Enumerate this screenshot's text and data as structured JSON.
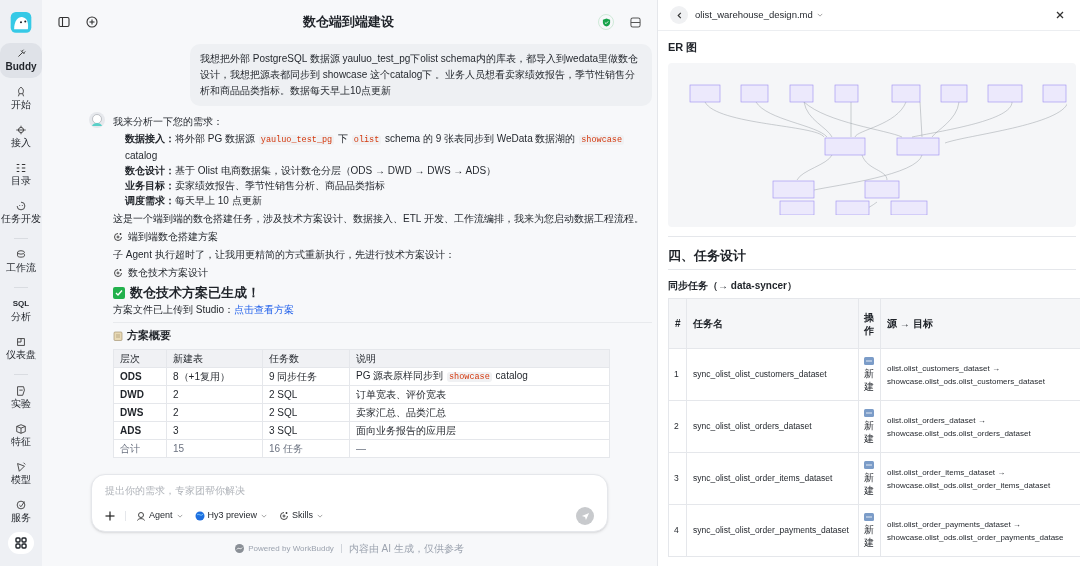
{
  "sidebar": {
    "groups": [
      [
        {
          "label": "Buddy",
          "selected": true
        },
        {
          "label": "开始",
          "selected": false
        },
        {
          "label": "接入",
          "selected": false
        },
        {
          "label": "目录",
          "selected": false
        },
        {
          "label": "任务开发",
          "selected": false
        }
      ],
      [
        {
          "label": "工作流",
          "selected": false
        }
      ],
      [
        {
          "label": "分析",
          "icon_text": "SQL",
          "selected": false
        },
        {
          "label": "仪表盘",
          "selected": false
        }
      ],
      [
        {
          "label": "实验",
          "selected": false
        },
        {
          "label": "特征",
          "selected": false
        },
        {
          "label": "模型",
          "selected": false
        },
        {
          "label": "服务",
          "selected": false
        }
      ]
    ]
  },
  "chat": {
    "title": "数仓端到端建设",
    "user_message": "我想把外部 PostgreSQL 数据源 yauluo_test_pg下olist schema内的库表，都导入到wedata里做数仓设计，我想把源表都同步到 showcase 这个catalog下 。业务人员想看卖家绩效报告，季节性销售分析和商品品类指标。数据每天早上10点更新",
    "reply": {
      "intro": "我来分析一下您的需求：",
      "requirements": [
        {
          "label": "数据接入：",
          "segments": [
            {
              "kind": "text",
              "text": "将外部 PG 数据源 "
            },
            {
              "kind": "code",
              "text": "yauluo_test_pg"
            },
            {
              "kind": "text",
              "text": " 下 "
            },
            {
              "kind": "code",
              "text": "olist"
            },
            {
              "kind": "text",
              "text": " schema 的 9 张表同步到 WeData 数据湖的 "
            },
            {
              "kind": "code",
              "text": "showcase"
            },
            {
              "kind": "text",
              "text": " catalog"
            }
          ]
        },
        {
          "label": "数仓设计：",
          "segments": [
            {
              "kind": "text",
              "text": "基于 Olist 电商数据集，设计数仓分层（ODS → DWD → DWS → ADS）"
            }
          ]
        },
        {
          "label": "业务目标：",
          "segments": [
            {
              "kind": "text",
              "text": "卖家绩效报告、季节性销售分析、商品品类指标"
            }
          ]
        },
        {
          "label": "调度需求：",
          "segments": [
            {
              "kind": "text",
              "text": "每天早上 10 点更新"
            }
          ]
        }
      ],
      "blocks": [
        {
          "kind": "paragraph",
          "text": "这是一个端到端的数仓搭建任务，涉及技术方案设计、数据接入、ETL 开发、工作流编排，我来为您启动数据工程流程。"
        },
        {
          "kind": "tool",
          "text": "端到端数仓搭建方案"
        },
        {
          "kind": "paragraph",
          "text": "子 Agent 执行超时了，让我用更精简的方式重新执行，先进行技术方案设计："
        },
        {
          "kind": "tool",
          "text": "数仓技术方案设计"
        }
      ],
      "result_heading": "数仓技术方案已生成！",
      "upload_note": "方案文件已上传到 Studio：",
      "upload_link": "点击查看方案",
      "summary_heading": "方案概要",
      "summary_table": {
        "columns": [
          "层次",
          "新建表",
          "任务数",
          "说明"
        ],
        "rows": [
          {
            "cells": [
              {
                "kind": "text",
                "text": "ODS"
              },
              {
                "kind": "text",
                "text": "8（+1复用）"
              },
              {
                "kind": "text",
                "text": "9 同步任务"
              },
              {
                "kind": "mixed",
                "segments": [
                  {
                    "kind": "text",
                    "text": "PG 源表原样同步到 "
                  },
                  {
                    "kind": "code",
                    "text": "showcase"
                  },
                  {
                    "kind": "text",
                    "text": " catalog"
                  }
                ]
              }
            ],
            "total": false
          },
          {
            "cells": [
              {
                "kind": "text",
                "text": "DWD"
              },
              {
                "kind": "text",
                "text": "2"
              },
              {
                "kind": "text",
                "text": "2 SQL"
              },
              {
                "kind": "text",
                "text": "订单宽表、评价宽表"
              }
            ],
            "total": false
          },
          {
            "cells": [
              {
                "kind": "text",
                "text": "DWS"
              },
              {
                "kind": "text",
                "text": "2"
              },
              {
                "kind": "text",
                "text": "2 SQL"
              },
              {
                "kind": "text",
                "text": "卖家汇总、品类汇总"
              }
            ],
            "total": false
          },
          {
            "cells": [
              {
                "kind": "text",
                "text": "ADS"
              },
              {
                "kind": "text",
                "text": "3"
              },
              {
                "kind": "text",
                "text": "3 SQL"
              },
              {
                "kind": "text",
                "text": "面向业务报告的应用层"
              }
            ],
            "total": false
          },
          {
            "cells": [
              {
                "kind": "text",
                "text": "合计"
              },
              {
                "kind": "text",
                "text": "15"
              },
              {
                "kind": "text",
                "text": "16 任务"
              },
              {
                "kind": "text",
                "text": "—"
              }
            ],
            "total": true
          }
        ]
      }
    },
    "composer": {
      "placeholder": "提出你的需求，专家团帮你解决",
      "chips": [
        "Agent",
        "Hy3 preview",
        "Skills"
      ]
    },
    "footer": {
      "powered": "Powered by WorkBuddy",
      "note": "内容由 AI 生成，仅供参考"
    }
  },
  "document": {
    "file_name": "olist_warehouse_design.md",
    "er_heading": "ER 图",
    "section_heading": "四、任务设计",
    "subheading": "同步任务（→ data-syncer）",
    "task_table": {
      "columns": [
        "#",
        "任务名",
        "操作",
        "源 → 目标"
      ],
      "rows": [
        {
          "num": "1",
          "name": "sync_olist_olist_customers_dataset",
          "action": "新建",
          "source": "olist.olist_customers_dataset →",
          "target": "showcase.olist_ods.olist_customers_dataset"
        },
        {
          "num": "2",
          "name": "sync_olist_olist_orders_dataset",
          "action": "新建",
          "source": "olist.olist_orders_dataset →",
          "target": "showcase.olist_ods.olist_orders_dataset"
        },
        {
          "num": "3",
          "name": "sync_olist_olist_order_items_dataset",
          "action": "新建",
          "source": "olist.olist_order_items_dataset →",
          "target": "showcase.olist_ods.olist_order_items_dataset"
        },
        {
          "num": "4",
          "name": "sync_olist_olist_order_payments_dataset",
          "action": "新建",
          "source": "olist.olist_order_payments_dataset →",
          "target": "showcase.olist_ods.olist_order_payments_datase"
        }
      ]
    }
  }
}
